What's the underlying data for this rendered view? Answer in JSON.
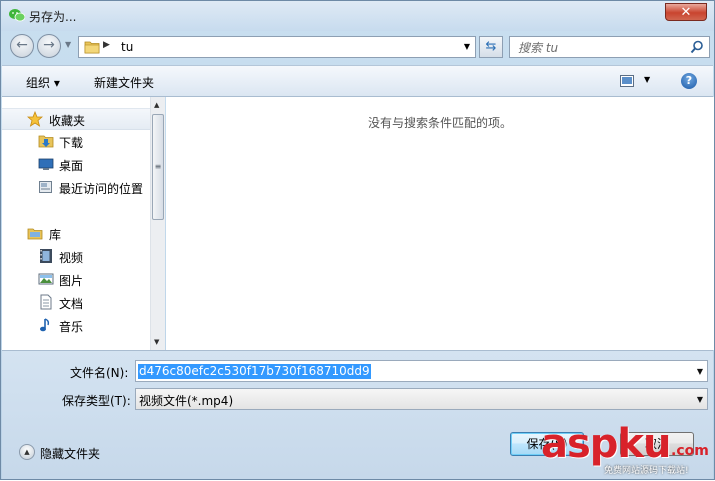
{
  "window": {
    "title": "另存为...",
    "close_label": "✕"
  },
  "nav": {
    "address_path": "tu",
    "search_placeholder": "搜索 tu"
  },
  "toolbar": {
    "organize_label": "组织 ▾",
    "new_folder_label": "新建文件夹"
  },
  "sidebar": {
    "favorites_label": "收藏夹",
    "favorites": [
      {
        "label": "下载"
      },
      {
        "label": "桌面"
      },
      {
        "label": "最近访问的位置"
      }
    ],
    "libraries_label": "库",
    "libraries": [
      {
        "label": "视频"
      },
      {
        "label": "图片"
      },
      {
        "label": "文档"
      },
      {
        "label": "音乐"
      }
    ]
  },
  "content": {
    "empty_message": "没有与搜索条件匹配的项。"
  },
  "form": {
    "filename_label": "文件名(N):",
    "filename_value": "d476c80efc2c530f17b730f168710dd9",
    "filetype_label": "保存类型(T):",
    "filetype_value": "视频文件(*.mp4)"
  },
  "footer": {
    "hide_folders_label": "隐藏文件夹",
    "save_label": "保存(S)",
    "cancel_label": "取消"
  },
  "watermark": {
    "brand": "aspku",
    "tld": ".com",
    "tagline": "免费网站源码下载站!"
  },
  "colors": {
    "selection": "#3399ff",
    "close_button": "#c9442f",
    "watermark": "#d8222a"
  }
}
